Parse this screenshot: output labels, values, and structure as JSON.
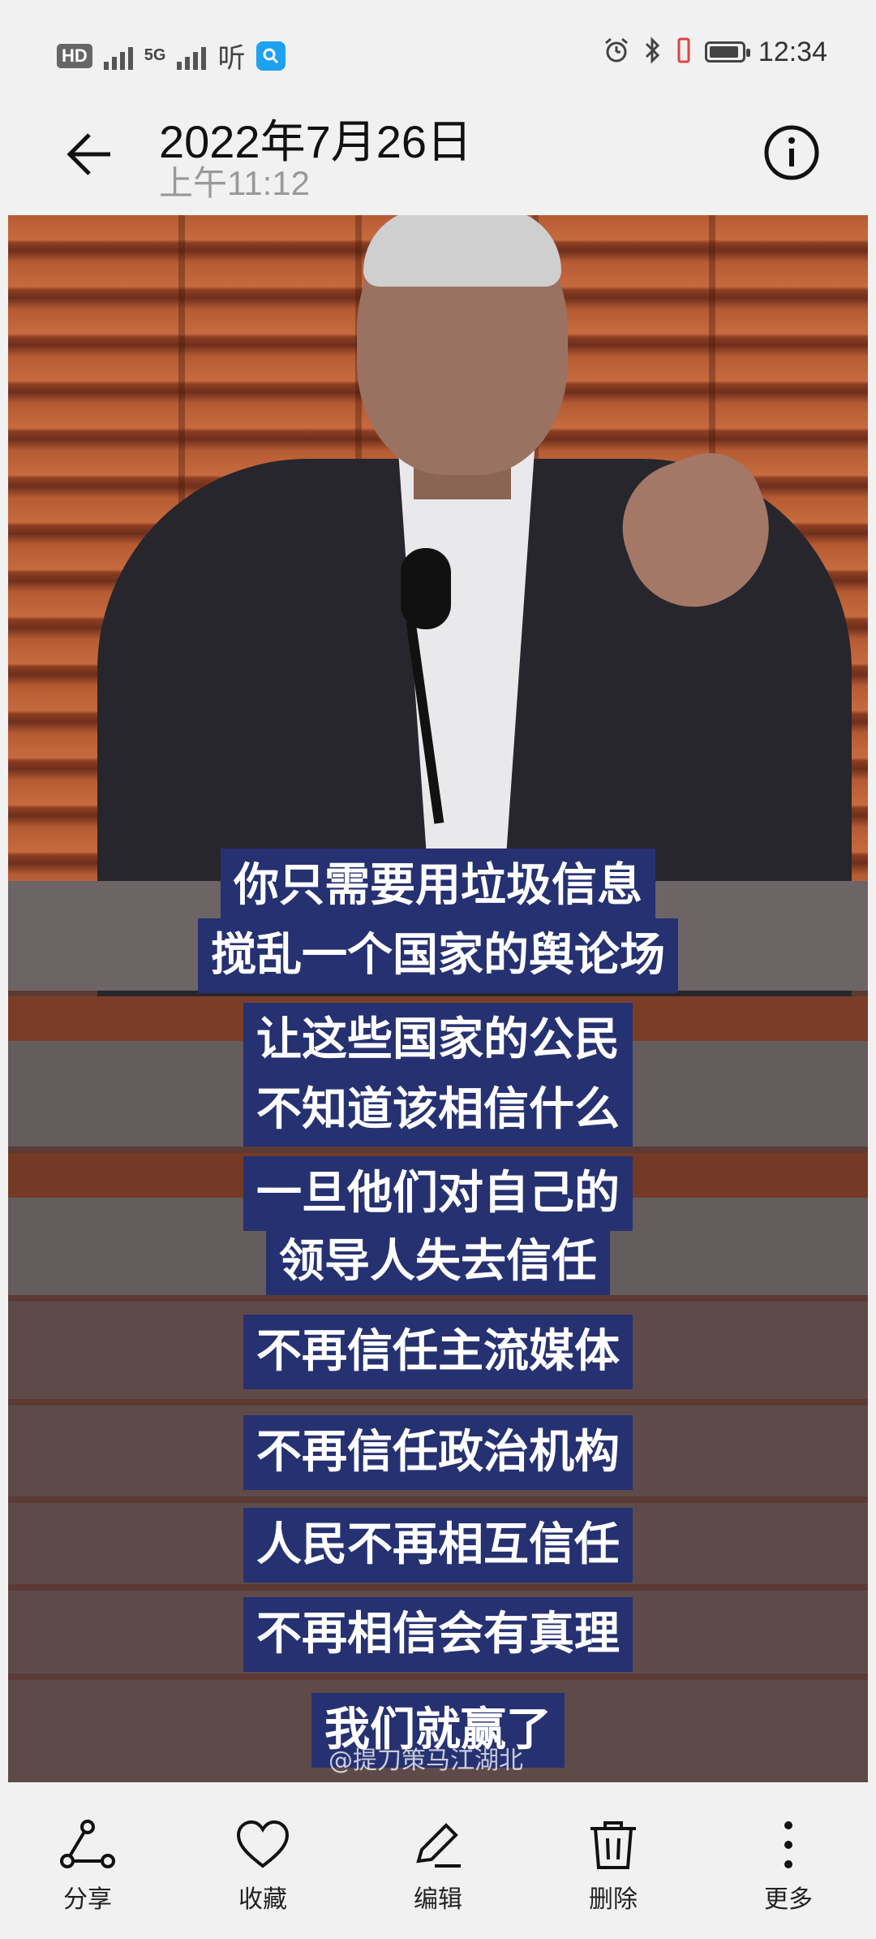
{
  "status_bar": {
    "left_badges": [
      "HD",
      "5G"
    ],
    "listen_label": "听",
    "time": "12:34",
    "battery_level_percent": 80
  },
  "header": {
    "date": "2022年7月26日",
    "time": "上午11:12"
  },
  "image": {
    "captions": [
      "你只需要用垃圾信息",
      "搅乱一个国家的舆论场",
      "让这些国家的公民",
      "不知道该相信什么",
      "一旦他们对自己的",
      "领导人失去信任",
      "不再信任主流媒体",
      "不再信任政治机构",
      "人民不再相互信任",
      "不再相信会有真理",
      "我们就赢了"
    ],
    "watermark": "@提刀策马江湖北"
  },
  "actions": [
    {
      "icon": "share-icon",
      "label": "分享"
    },
    {
      "icon": "heart-icon",
      "label": "收藏"
    },
    {
      "icon": "edit-icon",
      "label": "编辑"
    },
    {
      "icon": "trash-icon",
      "label": "删除"
    },
    {
      "icon": "more-icon",
      "label": "更多"
    }
  ]
}
